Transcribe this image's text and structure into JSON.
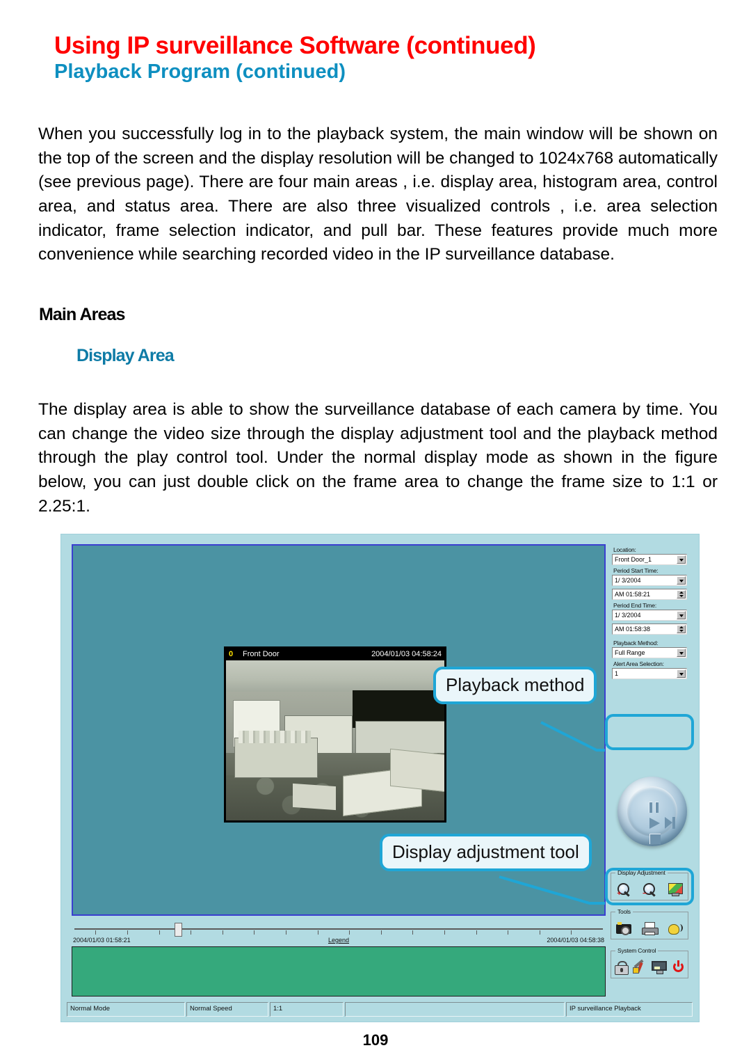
{
  "page": {
    "number": "109",
    "title_main": "Using IP surveillance Software (continued)",
    "title_sub": "Playback  Program  (continued)",
    "colors": {
      "title_main": "#ff0000",
      "title_sub": "#0e8fc0",
      "section_accent": "#0e7ba6",
      "callout_border": "#1fa6d6",
      "figure_bg": "#b2dbe2",
      "display_bg": "#4b93a3",
      "histogram": "#35a97c"
    }
  },
  "body": {
    "paragraph1": "When you successfully log in to the playback system, the main window will be shown on the top of the screen and the display resolution will be changed to 1024x768 automatically (see previous page). There are four main areas , i.e. display area, histogram area, control area, and status area. There are also three visualized controls , i.e. area selection indicator, frame selection indicator, and pull bar. These features provide much more convenience while searching recorded video in the IP surveillance database.",
    "heading_main_areas": "Main Areas",
    "heading_display_area": "Display Area",
    "paragraph2": "The display area is able to show the surveillance database of each camera by time. You can change the video size through the display adjustment tool and the playback method through the play control tool. Under the normal display mode as shown in the figure below, you can just double click on the frame area to change the frame size to 1:1 or 2.25:1."
  },
  "figure": {
    "callouts": {
      "playback_method": "Playback method",
      "display_adjustment_tool": "Display adjustment tool"
    },
    "video": {
      "channel_number": "0",
      "camera_name": "Front Door",
      "timestamp": "2004/01/03 04:58:24"
    },
    "controls": {
      "location_label": "Location:",
      "location_value": "Front Door_1",
      "period_start_label": "Period Start Time:",
      "period_start_date": "1/ 3/2004",
      "period_start_time": "AM 01:58:21",
      "period_end_label": "Period End Time:",
      "period_end_date": "1/ 3/2004",
      "period_end_time": "AM 01:58:38",
      "playback_method_label": "Playback Method:",
      "playback_method_value": "Full Range",
      "alert_area_label": "Alert Area Selection:",
      "alert_area_value": "1"
    },
    "groups": {
      "display_adjustment": {
        "title": "Display Adjustment",
        "icons": [
          "zoom-in-icon",
          "zoom-out-icon",
          "display-color-icon"
        ]
      },
      "tools": {
        "title": "Tools",
        "icons": [
          "snapshot-camera-icon",
          "print-icon",
          "sound-icon"
        ]
      },
      "system_control": {
        "title": "System Control",
        "icons": [
          "lock-icon",
          "settings-icon",
          "monitor-icon",
          "power-icon"
        ]
      }
    },
    "play_control": {
      "buttons": [
        "pause-button",
        "play-button",
        "next-frame-button",
        "stop-button"
      ]
    },
    "timeline": {
      "start_label": "2004/01/03 01:58:21",
      "legend_label": "Legend",
      "end_label": "2004/01/03 04:58:38"
    },
    "statusbar": {
      "mode": "Normal Mode",
      "speed": "Normal Speed",
      "ratio": "1:1",
      "blank": "",
      "app": "IP surveillance  Playback"
    }
  }
}
